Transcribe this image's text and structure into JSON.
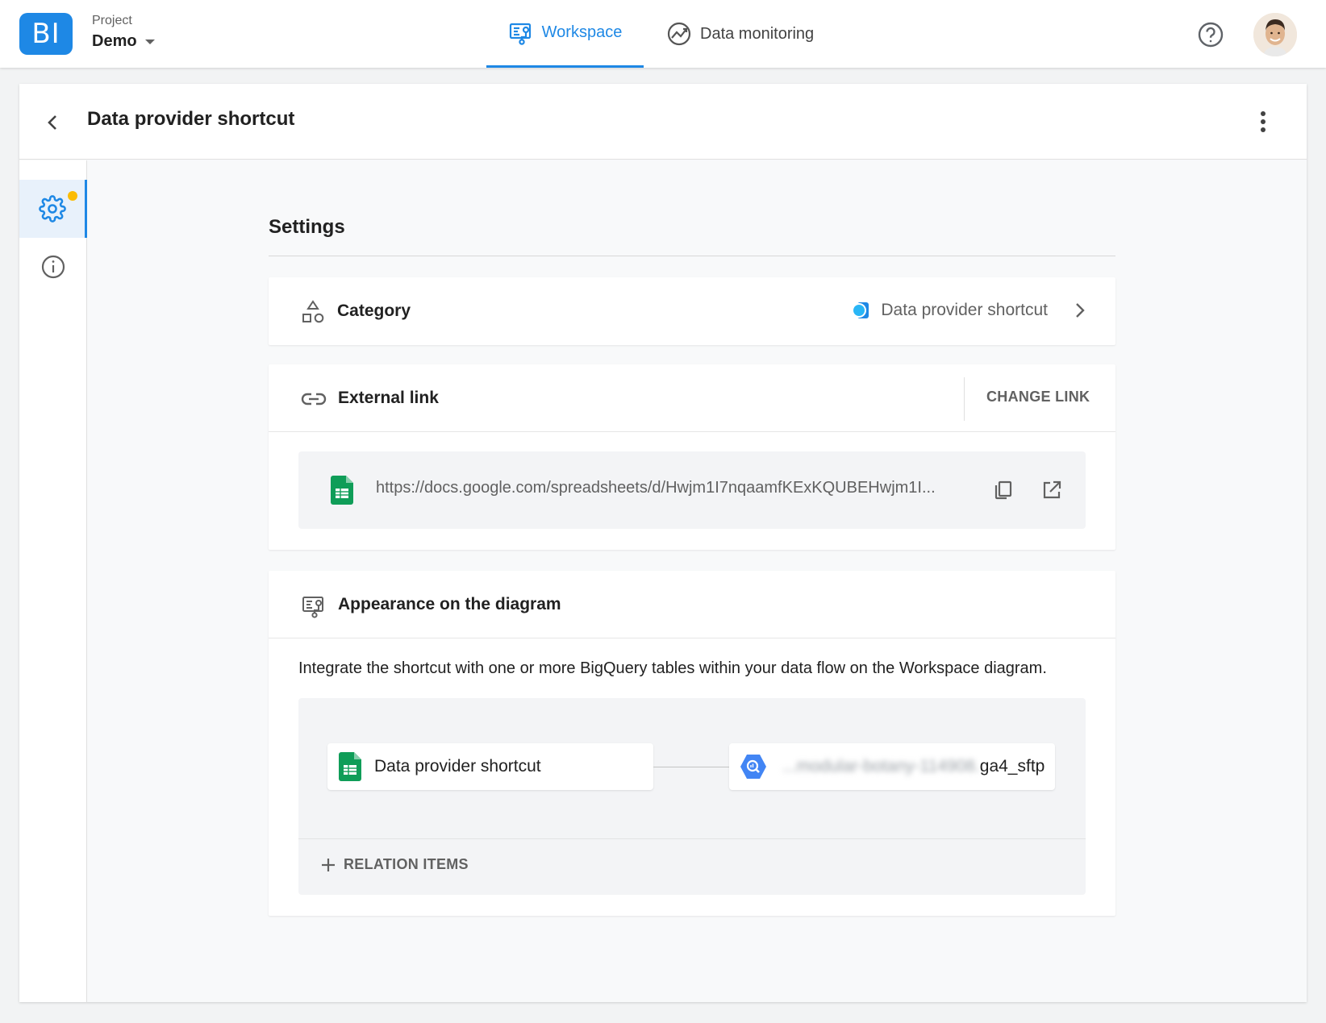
{
  "app": {
    "logo_text": "BI",
    "project_label": "Project",
    "project_name": "Demo"
  },
  "nav": {
    "tabs": [
      {
        "label": "Workspace",
        "icon": "workspace-icon",
        "active": true
      },
      {
        "label": "Data monitoring",
        "icon": "monitoring-icon",
        "active": false
      }
    ]
  },
  "header": {
    "title": "Data provider shortcut"
  },
  "sidebar": {
    "items": [
      {
        "icon": "gear-icon",
        "active": true,
        "has_notification_dot": true
      },
      {
        "icon": "info-icon",
        "active": false
      }
    ]
  },
  "settings": {
    "title": "Settings",
    "category": {
      "label": "Category",
      "value": "Data provider shortcut"
    },
    "external_link": {
      "label": "External link",
      "change_button": "CHANGE LINK",
      "url": "https://docs.google.com/spreadsheets/d/Hwjm1I7nqaamfKExKQUBEHwjm1I..."
    },
    "appearance": {
      "label": "Appearance on the diagram",
      "description": "Integrate the shortcut with one or more BigQuery tables within your data flow on the Workspace diagram.",
      "source_node": "Data provider shortcut",
      "target_node_blurred": "...modular-botany-114908.",
      "target_node_suffix": "ga4_sftp",
      "add_relation_label": "RELATION ITEMS"
    }
  },
  "colors": {
    "accent": "#1e88e5",
    "notification": "#fbbc04",
    "sheets_green": "#0f9d58",
    "bigquery_blue": "#4285f4"
  }
}
